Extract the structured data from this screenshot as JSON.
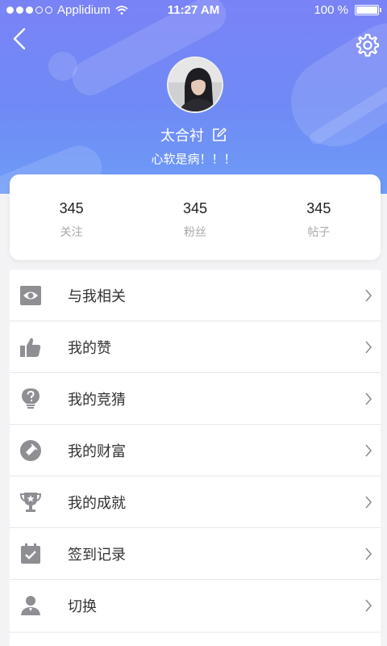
{
  "status_bar": {
    "carrier": "Applidium",
    "time": "11:27 AM",
    "battery": "100 %"
  },
  "profile": {
    "name": "太合衬",
    "signature": "心软是病！！！"
  },
  "stats": [
    {
      "value": "345",
      "label": "关注"
    },
    {
      "value": "345",
      "label": "粉丝"
    },
    {
      "value": "345",
      "label": "帖子"
    }
  ],
  "menu": [
    {
      "label": "与我相关",
      "icon": "eye-icon"
    },
    {
      "label": "我的赞",
      "icon": "thumbs-up-icon"
    },
    {
      "label": "我的竞猜",
      "icon": "question-bulb-icon"
    },
    {
      "label": "我的财富",
      "icon": "coin-icon"
    },
    {
      "label": "我的成就",
      "icon": "trophy-icon"
    },
    {
      "label": "签到记录",
      "icon": "calendar-check-icon"
    },
    {
      "label": "切换",
      "icon": "user-icon"
    }
  ],
  "colors": {
    "header_gradient_top": "#7a83f6",
    "header_gradient_bottom": "#6e9cf7",
    "icon_gray": "#8e8e93"
  }
}
